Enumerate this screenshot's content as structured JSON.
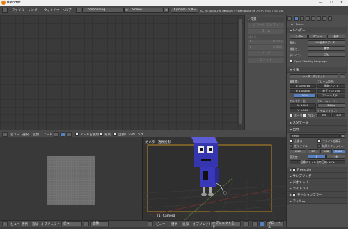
{
  "window": {
    "title": "Blender",
    "min": "—",
    "max": "☐",
    "close": "✕"
  },
  "menu": [
    "ファイル",
    "レンダー",
    "ウィンドウ",
    "ヘルプ"
  ],
  "screen_layout": "Compositing",
  "scene": "Scene",
  "render_engine": "Cyclesレンダー",
  "stats": "v2.79 | 頂点:8,294 | 面:8,096 | 三角面:16,078 | オブジェクト:0/3 | ランプ:0/1 | メモリ:26.77M | カメラ",
  "node_panel": {
    "node_header": "ノード",
    "nodes_label": "ノード",
    "name_label": "名前:",
    "name_value": "",
    "label_label": "ラベル:",
    "color_label": "カラー",
    "properties_label": "プロパティ",
    "x_label": "X:",
    "x_value": "0.000",
    "y_label": "Y:",
    "y_value": "0.000",
    "scale_label": "スケール",
    "reset_label": "リセット",
    "backdrop": "背景",
    "button1": "カラーと アルファ",
    "button2": "ズーム",
    "offset_label": "オフセット",
    "fit_button": "フィット"
  },
  "node_header": {
    "view": "ビュー",
    "select": "選択",
    "add": "追加",
    "node": "ノード",
    "use_nodes": "ノードを使用",
    "backdrop": "背景",
    "auto_render": "自動レンダリング"
  },
  "image_header": {
    "view": "ビュー",
    "image": "画像"
  },
  "viewport": {
    "label": "カメラ・透視投影",
    "object": "(1) Camera"
  },
  "bottom_bar": {
    "view": "ビュー",
    "select": "選択",
    "add": "追加",
    "object": "オブジェクト",
    "mode": "オブジェクトモード",
    "global": "グローバル",
    "view2": "ビュー",
    "image": "画像"
  },
  "props": {
    "scene_path": "Scene",
    "render_section": "レンダー",
    "render_btn": "レンダー",
    "animation_btn": "アニメー",
    "audio_btn": "音声",
    "display_label": "表示:",
    "display_value": "UV/画像エディター",
    "feature_label": "機能セット:",
    "feature_value": "標準",
    "device_label": "デバイス:",
    "device_value": "CPU",
    "osl": "Open Shading Language",
    "dims_section": "寸法",
    "preset_value": "レンダープリセット",
    "resolution_label": "解像度:",
    "res_x": "X: 1920 px",
    "res_y": "Y: 1080 px",
    "res_pct": "50%",
    "frame_range_label": "フレーム範囲:",
    "start": "開始フレ: 1",
    "end": "終了フレ: 250",
    "step": "フレームステ: 1",
    "aspect_label": "アスペクト比:",
    "asp_x": "X: 1.000",
    "asp_y": "Y: 1.000",
    "fps_label": "フレームレート:",
    "fps_value": "24 fps",
    "remap_label": "タイムリマップ:",
    "remap_old": "100",
    "remap_new": "100",
    "border": "ボーダー",
    "crop": "クロップ",
    "metadata_section": "メタデータ",
    "output_section": "出力",
    "output_path": "/tmp\\",
    "overwrite": "上書き",
    "file_ext": "ファイル拡張子",
    "placeholders": "仮ファイル",
    "cache": "結果をキャッシュ",
    "format": "PNG",
    "bw": "BW",
    "rgb": "RGB",
    "rgba": "RGBA",
    "color_depth_label": "色深度:",
    "depth_8": "8",
    "depth_16": "16",
    "compression_label": "画像ファイル化の圧縮:",
    "compression_value": "15%",
    "freestyle": "Freestyle",
    "sampling": "サンプリング",
    "geometry": "ジオメトリ",
    "light_paths": "ライトパス",
    "motion_blur": "モーションブラー",
    "film": "フィルム"
  },
  "colors": {
    "accent_blue": "#5680c2",
    "blender_orange": "#e87d0d",
    "robot_blue": "#3939b8",
    "camera_frame": "#e0a020"
  }
}
